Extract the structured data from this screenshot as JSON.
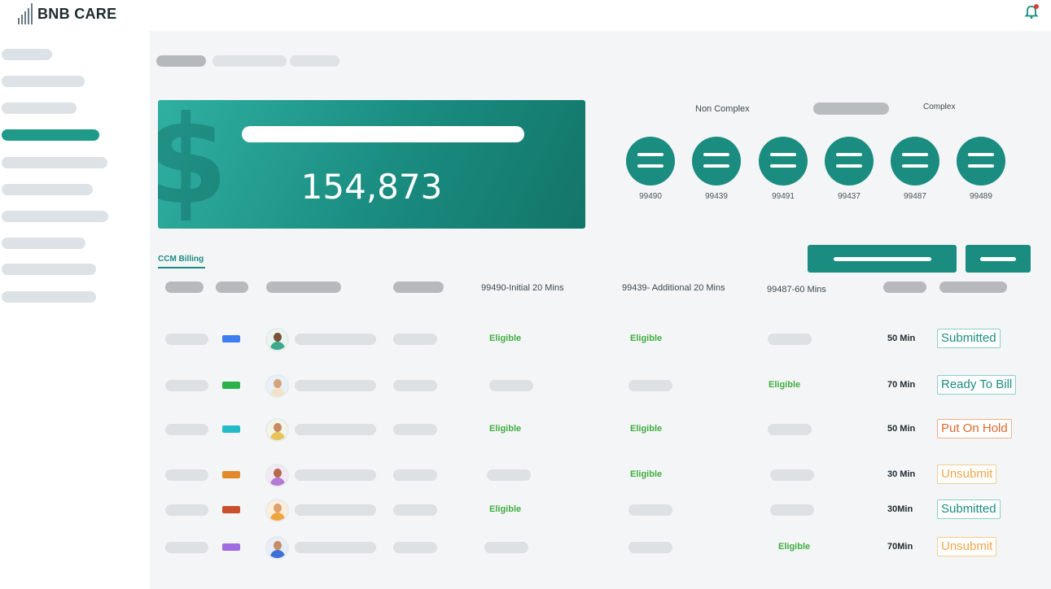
{
  "brand": {
    "name": "BNB CARE"
  },
  "header": {
    "notification_icon": "bell-icon",
    "notification_dot_color": "#e53935"
  },
  "hero": {
    "value": "154,873",
    "icon": "dollar-icon"
  },
  "categories": {
    "left_label": "Non Complex",
    "right_label": "Complex"
  },
  "cpt_codes": [
    "99490",
    "99439",
    "99491",
    "99437",
    "99487",
    "99489"
  ],
  "tab": {
    "label": "CCM Billing"
  },
  "table": {
    "headers": [
      "99490-Initial 20 Mins",
      "99439- Additional 20 Mins",
      "99487-60 Mins"
    ],
    "rows": [
      {
        "swatch": "#3d7ef0",
        "c1": "Eligible",
        "c2": "Eligible",
        "c3": "",
        "minutes": "50 Min",
        "status": "Submitted",
        "status_style": "sub"
      },
      {
        "swatch": "#2bb24a",
        "c1": "",
        "c2": "",
        "c3": "Eligible",
        "minutes": "70 Min",
        "status": "Ready To Bill",
        "status_style": "ready"
      },
      {
        "swatch": "#22bcc8",
        "c1": "Eligible",
        "c2": "Eligible",
        "c3": "",
        "minutes": "50 Min",
        "status": "Put On Hold",
        "status_style": "hold"
      },
      {
        "swatch": "#e08a2a",
        "c1": "",
        "c2": "Eligible",
        "c3": "",
        "minutes": "30 Min",
        "status": "Unsubmit",
        "status_style": "uns"
      },
      {
        "swatch": "#c9502a",
        "c1": "Eligible",
        "c2": "",
        "c3": "",
        "minutes": "30Min",
        "status": "Submitted",
        "status_style": "sub"
      },
      {
        "swatch": "#a06de0",
        "c1": "",
        "c2": "",
        "c3": "Eligible",
        "minutes": "70Min",
        "status": "Unsubmit",
        "status_style": "uns"
      }
    ]
  },
  "colors": {
    "accent": "#1a8c80",
    "eligible": "#3fae3f"
  }
}
